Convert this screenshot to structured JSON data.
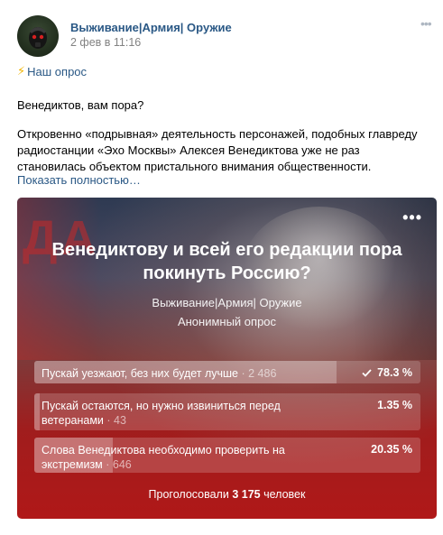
{
  "post": {
    "author": "Выживание|Армия| Оружие",
    "date": "2 фев в 11:16",
    "tag": "Наш опрос",
    "text_line1": "Венедиктов, вам пора?",
    "text_paragraph": "Откровенно «подрывная» деятельность персонажей, подобных главреду радиостанции «Эхо Москвы» Алексея Венедиктова уже не раз становилась объектом пристального внимания общественности.",
    "show_more": "Показать полностью…"
  },
  "poll": {
    "title": "Венедиктову и всей его редакции пора покинуть Россию?",
    "author": "Выживание|Армия| Оружие",
    "type": "Анонимный опрос",
    "background_letters": "ДА",
    "answers": [
      {
        "label": "Пускай уезжают, без них будет лучше",
        "count": "· 2 486",
        "percent": "78.3 %",
        "share": 0.783,
        "voted": true
      },
      {
        "label": "Пускай остаются, но нужно извиниться перед ветеранами",
        "count": "· 43",
        "percent": "1.35 %",
        "share": 0.0135,
        "voted": false
      },
      {
        "label": "Слова Венедиктова необходимо проверить на экстремизм",
        "count": "· 646",
        "percent": "20.35 %",
        "share": 0.2035,
        "voted": false
      }
    ],
    "voted_prefix": "Проголосовали",
    "voted_count": "3 175",
    "voted_suffix": "человек"
  },
  "colors": {
    "link": "#2a5885",
    "muted": "#828282",
    "poll_red": "#b01818"
  },
  "icons": {
    "avatar": "skull-mask-avatar",
    "tag": "lightning-icon",
    "post_menu": "more-dots-icon",
    "poll_menu": "more-dots-icon",
    "voted": "checkmark-icon"
  }
}
